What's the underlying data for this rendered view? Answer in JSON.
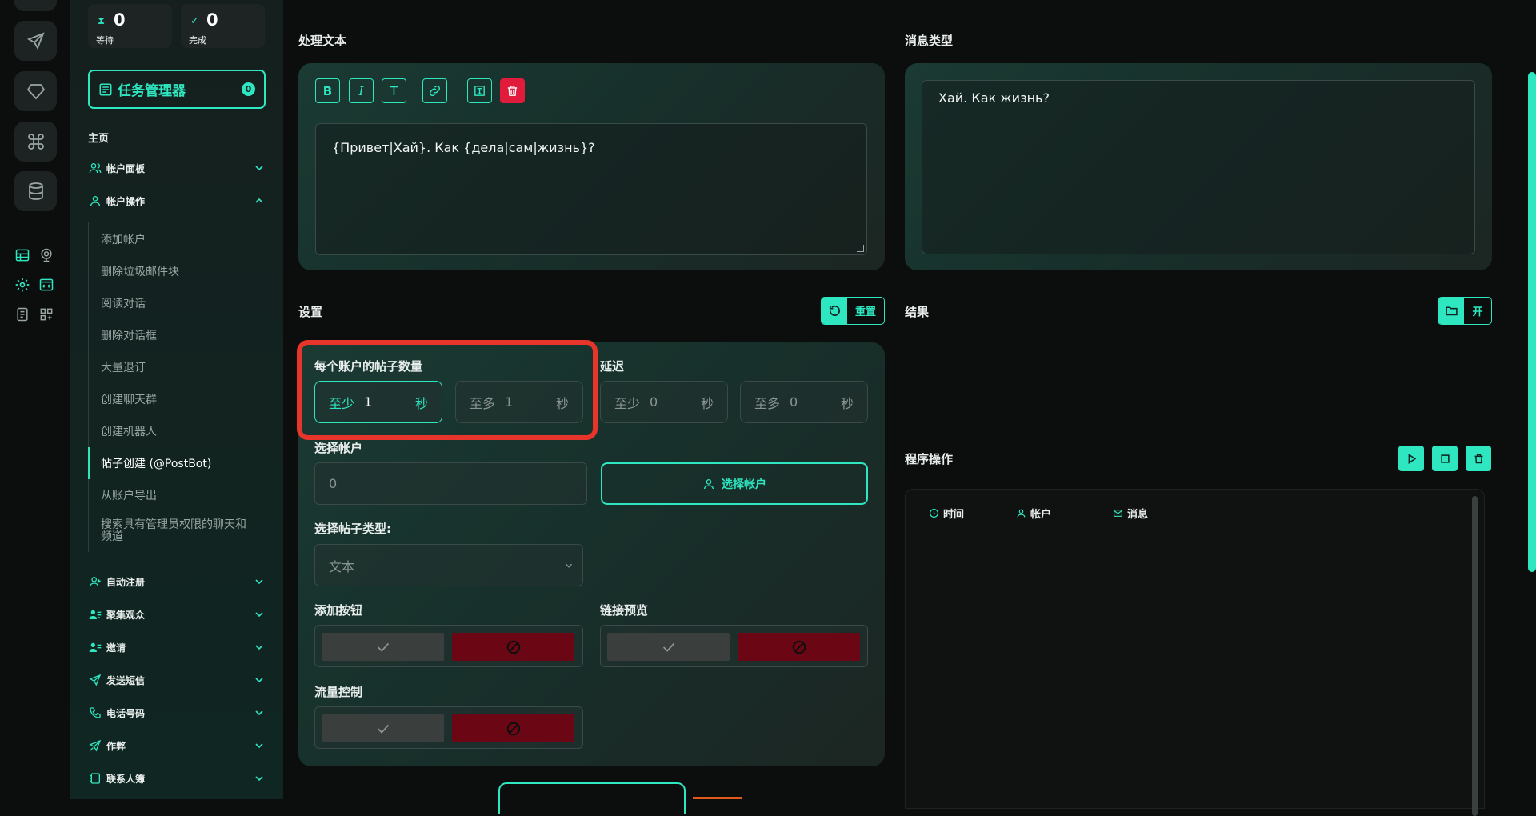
{
  "stats": [
    {
      "icon": "hourglass-icon",
      "value": "0",
      "label": "等待"
    },
    {
      "icon": "check-circle-icon",
      "value": "0",
      "label": "完成"
    }
  ],
  "task_manager": {
    "label": "任务管理器",
    "badge": "0"
  },
  "nav": {
    "section_title": "主页",
    "items": [
      {
        "label": "帐户面板",
        "icon": "users-icon"
      },
      {
        "label": "帐户操作",
        "icon": "user-icon"
      }
    ],
    "sub_items": [
      "添加帐户",
      "删除垃圾邮件块",
      "阅读对话",
      "删除对话框",
      "大量退订",
      "创建聊天群",
      "创建机器人",
      "帖子创建 (@PostBot)",
      "从账户导出",
      "搜索具有管理员权限的聊天和频道"
    ],
    "more_items": [
      {
        "label": "自动注册",
        "icon": "user-plus-icon"
      },
      {
        "label": "聚集观众",
        "icon": "users-list-icon"
      },
      {
        "label": "邀请",
        "icon": "user-invite-icon"
      },
      {
        "label": "发送短信",
        "icon": "send-icon"
      },
      {
        "label": "电话号码",
        "icon": "phone-icon"
      },
      {
        "label": "作弊",
        "icon": "megaphone-icon"
      },
      {
        "label": "联系人簿",
        "icon": "book-icon"
      }
    ]
  },
  "editor": {
    "section_label": "处理文本",
    "toolbar": [
      "B",
      "I",
      "T"
    ],
    "text": "{Привет|Хай}. Как {дела|сам|жизнь}?"
  },
  "preview": {
    "section_label": "消息类型",
    "text": "Хай. Как жизнь?"
  },
  "settings": {
    "section_label": "设置",
    "reset_label": "重置",
    "posts_per_account_label": "每个账户的帖子数量",
    "delay_label": "延迟",
    "posts_min": {
      "prefix": "至少",
      "value": "1",
      "unit": "秒"
    },
    "posts_max": {
      "prefix": "至多",
      "value": "1",
      "unit": "秒"
    },
    "delay_min": {
      "prefix": "至少",
      "value": "0",
      "unit": "秒"
    },
    "delay_max": {
      "prefix": "至多",
      "value": "0",
      "unit": "秒"
    },
    "select_accounts_label": "选择帐户",
    "select_accounts_value": "0",
    "select_accounts_button": "选择帐户",
    "post_type_label": "选择帖子类型:",
    "post_type_value": "文本",
    "add_button_label": "添加按钮",
    "link_preview_label": "链接预览",
    "flow_control_label": "流量控制"
  },
  "results": {
    "section_label": "结果",
    "open_label": "开"
  },
  "program": {
    "section_label": "程序操作",
    "columns": [
      "时间",
      "帐户",
      "消息"
    ]
  },
  "colors": {
    "accent": "#2ee6c0",
    "danger": "#e01b3c",
    "highlight": "#e8352b"
  }
}
